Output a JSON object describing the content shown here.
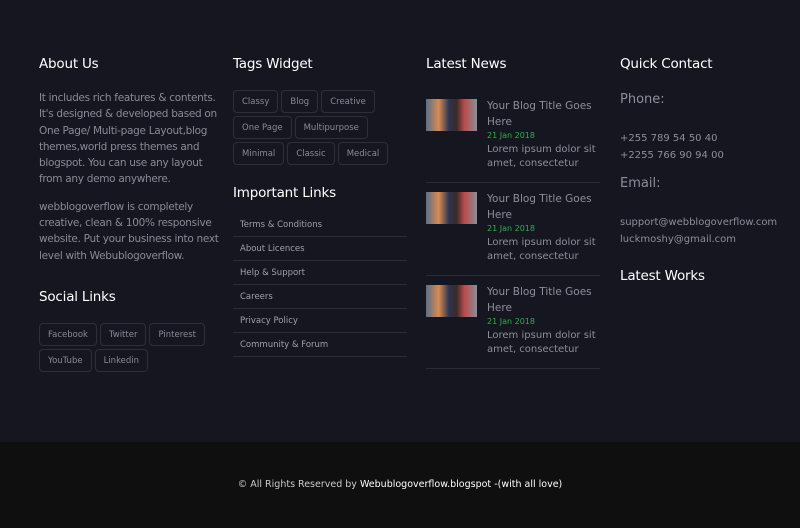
{
  "about": {
    "title": "About Us",
    "p1": "It includes rich features & contents. It's designed & developed based on One Page/ Multi-page Layout,blog themes,world press themes and blogspot. You can use any layout from any demo anywhere.",
    "p2": "webblogoverflow is completely creative, clean & 100% responsive website. Put your business into next level with Webublogoverflow."
  },
  "social": {
    "title": "Social Links",
    "items": [
      "Facebook",
      "Twitter",
      "Pinterest",
      "YouTube",
      "Linkedin"
    ]
  },
  "tags": {
    "title": "Tags Widget",
    "items": [
      "Classy",
      "Blog",
      "Creative",
      "One Page",
      "Multipurpose",
      "Minimal",
      "Classic",
      "Medical"
    ]
  },
  "links": {
    "title": "Important Links",
    "items": [
      "Terms & Conditions",
      "About Licences",
      "Help & Support",
      "Careers",
      "Privacy Policy",
      "Community & Forum"
    ]
  },
  "news": {
    "title": "Latest News",
    "items": [
      {
        "title": "Your Blog Title Goes Here",
        "date": "21 Jan 2018",
        "excerpt": "Lorem ipsum dolor sit amet, consectetur"
      },
      {
        "title": "Your Blog Title Goes Here",
        "date": "21 Jan 2018",
        "excerpt": "Lorem ipsum dolor sit amet, consectetur"
      },
      {
        "title": "Your Blog Title Goes Here",
        "date": "21 Jan 2018",
        "excerpt": "Lorem ipsum dolor sit amet, consectetur"
      }
    ]
  },
  "contact": {
    "title": "Quick Contact",
    "phone_label": "Phone:",
    "phones": [
      "+255 789 54 50 40",
      "+2255 766 90 94 00"
    ],
    "email_label": "Email:",
    "emails": [
      "support@webblogoverflow.com",
      "luckmoshy@gmail.com"
    ],
    "works_title": "Latest Works"
  },
  "footer": {
    "prefix": "© All Rights Reserved by",
    "brand": "Webublogoverflow.blogspot",
    "suffix": "-(with all love)"
  },
  "colors": {
    "background": "#161621",
    "footer": "#0f0f0f",
    "date": "#2fae4a"
  }
}
